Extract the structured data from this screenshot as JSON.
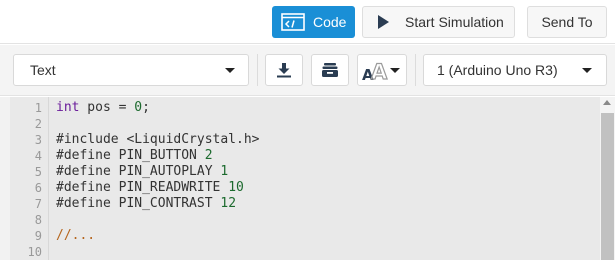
{
  "topbar": {
    "code_label": "Code",
    "simulation_label": "Start Simulation",
    "send_label": "Send To"
  },
  "toolbar": {
    "mode_value": "Text",
    "board_value": "1 (Arduino Uno R3)"
  },
  "editor": {
    "lines": [
      {
        "number": "1",
        "text": "int pos = 0;"
      },
      {
        "number": "2",
        "text": ""
      },
      {
        "number": "3",
        "text": "#include <LiquidCrystal.h>"
      },
      {
        "number": "4",
        "text": "#define PIN_BUTTON 2"
      },
      {
        "number": "5",
        "text": "#define PIN_AUTOPLAY 1"
      },
      {
        "number": "6",
        "text": "#define PIN_READWRITE 10"
      },
      {
        "number": "7",
        "text": "#define PIN_CONTRAST 12"
      },
      {
        "number": "8",
        "text": ""
      },
      {
        "number": "9",
        "text": "//..."
      },
      {
        "number": "10",
        "text": ""
      }
    ]
  },
  "icons": {
    "code": "code-icon",
    "play": "play-icon",
    "download": "download-icon",
    "library": "library-icon",
    "font_size": "font-size-icon",
    "dropdown": "chevron-down-icon"
  },
  "colors": {
    "accent": "#1a8fd6",
    "keyword": "#6a1c9a",
    "number": "#1c6a2e",
    "comment": "#b5651d"
  }
}
